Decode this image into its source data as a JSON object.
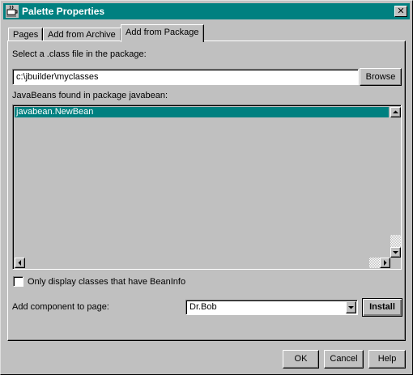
{
  "window": {
    "title": "Palette Properties",
    "app_icon": "coffee-cup-icon",
    "close_icon": "close-icon"
  },
  "tabs": [
    {
      "label": "Pages",
      "active": false
    },
    {
      "label": "Add from Archive",
      "active": false
    },
    {
      "label": "Add from Package",
      "active": true
    }
  ],
  "class_file": {
    "label": "Select a .class file in the package:",
    "value": "c:\\jbuilder\\myclasses",
    "browse_label": "Browse"
  },
  "beans": {
    "label": "JavaBeans found in package javabean:",
    "items": [
      "javabean.NewBean"
    ],
    "selected_index": 0
  },
  "beaninfo_option": {
    "label": "Only display classes that have BeanInfo",
    "checked": false
  },
  "add_to_page": {
    "label": "Add component to page:",
    "selected": "Dr.Bob",
    "install_label": "Install"
  },
  "footer": {
    "ok_label": "OK",
    "cancel_label": "Cancel",
    "help_label": "Help"
  },
  "colors": {
    "titlebar": "#008080",
    "selection": "#008080",
    "face": "#c0c0c0"
  }
}
